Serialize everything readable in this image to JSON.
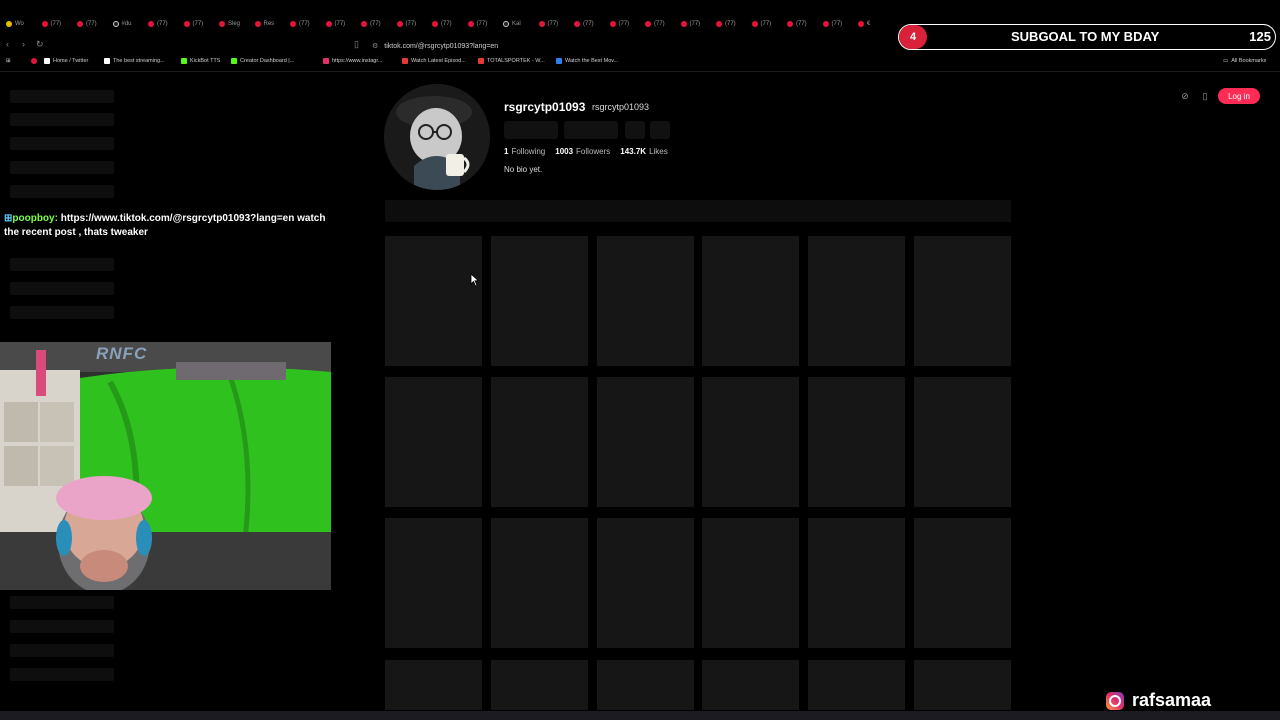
{
  "browser": {
    "tabs": [
      {
        "label": "Wo"
      },
      {
        "label": "(77)"
      },
      {
        "label": "(77)"
      },
      {
        "label": "#du"
      },
      {
        "label": "(77)"
      },
      {
        "label": "(77)"
      },
      {
        "label": "Sleg"
      },
      {
        "label": "Res"
      },
      {
        "label": "(77)"
      },
      {
        "label": "(77)"
      },
      {
        "label": "(77)"
      },
      {
        "label": "(77)"
      },
      {
        "label": "(77)"
      },
      {
        "label": "(77)"
      },
      {
        "label": "Kal"
      },
      {
        "label": "(77)"
      },
      {
        "label": "(77)"
      },
      {
        "label": "(77)"
      },
      {
        "label": "(77)"
      },
      {
        "label": "(77)"
      },
      {
        "label": "(77)"
      },
      {
        "label": "(77)"
      },
      {
        "label": "(77)"
      },
      {
        "label": "(77)"
      },
      {
        "label": "€"
      }
    ],
    "url": "tiktok.com/@rsgrcytp01093?lang=en",
    "bookmarks": [
      {
        "label": "Home / Twitter",
        "icon": "x-icon",
        "color": "#ffffff"
      },
      {
        "label": "The best streaming...",
        "icon": "diamond-icon",
        "color": "#ffffff"
      },
      {
        "label": "KickBot TTS",
        "icon": "kick-icon",
        "color": "#53fc18"
      },
      {
        "label": "Creator Dashboard |...",
        "icon": "kick-icon",
        "color": "#53fc18"
      },
      {
        "label": "https://www.instagr...",
        "icon": "instagram-icon",
        "color": "#e1306c"
      },
      {
        "label": "Watch Latest Episod...",
        "icon": "edit-icon",
        "color": "#e53935"
      },
      {
        "label": "TOTALSPORTEK - W...",
        "icon": "sport-icon",
        "color": "#e53935"
      },
      {
        "label": "Watch the Best Mov...",
        "icon": "movie-icon",
        "color": "#2f80ed"
      }
    ],
    "all_bookmarks": "All Bookmarks"
  },
  "profile": {
    "username": "rsgrcytp01093",
    "handle": "rsgrcytp01093",
    "following_count": "1",
    "following_label": "Following",
    "followers_count": "1003",
    "followers_label": "Followers",
    "likes_count": "143.7K",
    "likes_label": "Likes",
    "bio": "No bio yet.",
    "login_label": "Log in"
  },
  "chat": {
    "user": "poopboy",
    "message": "https://www.tiktok.com/@rsgrcytp01093?lang=en watch the recent post , thats tweaker"
  },
  "overlay": {
    "subgoal_count": "4",
    "subgoal_text": "SUBGOAL TO MY BDAY",
    "subgoal_target": "125",
    "credit_name": "rafsamaa",
    "webcam_logo": "RNFC"
  },
  "colors": {
    "login": "#fe2c55",
    "subgoal_badge": "#d9213a",
    "chat_user": "#7cff4a",
    "greenscreen": "#2fc21f"
  }
}
